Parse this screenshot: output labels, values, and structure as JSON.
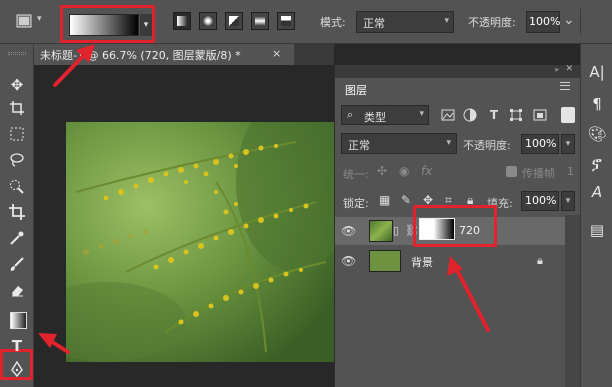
{
  "options_bar": {
    "mode_label": "模式:",
    "mode_value": "正常",
    "opacity_label": "不透明度:",
    "opacity_value": "100%",
    "dropdown_glyph": "⌄"
  },
  "document": {
    "tab_title": "未标题-1 @ 66.7% (720, 图层蒙版/8) *",
    "close_glyph": "×"
  },
  "layers_panel": {
    "title": "图层",
    "filter": {
      "value": "类型"
    },
    "blend_mode": "正常",
    "opacity_label": "不透明度:",
    "opacity_value": "100%",
    "unify_label": "统一:",
    "propagate_label": "传播帧",
    "propagate_value": "1",
    "lock_label": "锁定:",
    "fill_label": "填充:",
    "fill_value": "100%",
    "layers": [
      {
        "name": "720",
        "selected": true,
        "has_mask": true
      },
      {
        "name": "背景",
        "selected": false,
        "locked": true
      }
    ]
  },
  "toolbar": {
    "tools": [
      "move-icon",
      "artboard-icon",
      "marquee-icon",
      "lasso-icon",
      "quick-select-icon",
      "crop-icon",
      "eyedropper-icon",
      "brush-icon",
      "eraser-icon",
      "gradient-icon",
      "type-icon",
      "pen-icon"
    ],
    "active_tool": "gradient-icon"
  },
  "right_dock": {
    "icons": [
      "character-icon",
      "paragraph-icon",
      "swatches-icon",
      "glyphs-icon",
      "type-a-icon",
      "layers-comp-icon"
    ]
  },
  "colors": {
    "highlight": "#e0232d",
    "panel_bg": "#535353",
    "canvas_bg": "#282828",
    "selected_row": "#696969"
  }
}
